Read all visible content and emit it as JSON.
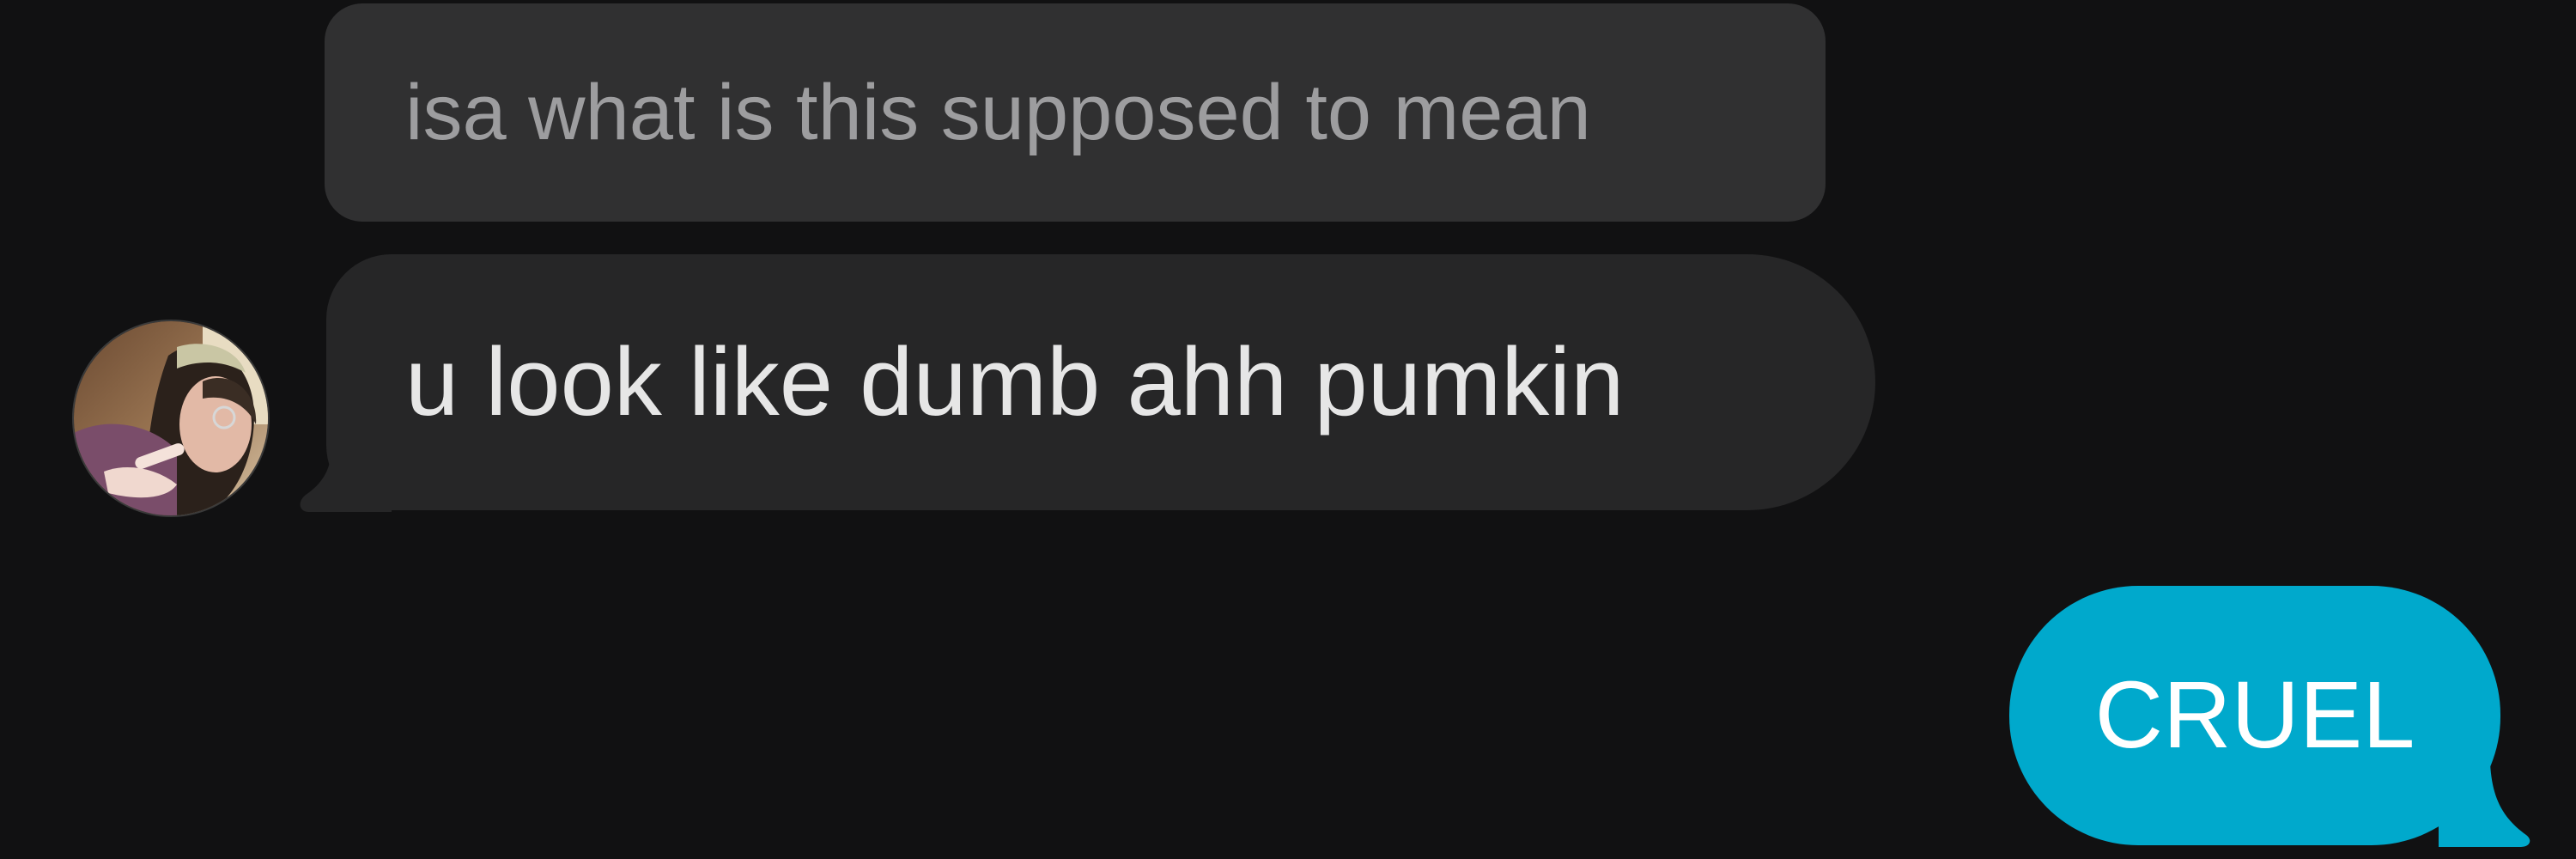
{
  "conversation": {
    "reply_preview": {
      "text": "isa what is this supposed to mean"
    },
    "messages": [
      {
        "direction": "incoming",
        "text": "u look like dumb ahh pumkin",
        "bubble_color": "#262627",
        "text_color": "#e6e6e6"
      },
      {
        "direction": "outgoing",
        "text": "CRUEL",
        "bubble_color": "#00a9cc",
        "text_color": "#ffffff"
      }
    ],
    "sender_avatar": {
      "icon": "user-avatar-photo"
    }
  },
  "theme": {
    "background": "#111112",
    "reply_preview_bg": "#303031",
    "reply_preview_text": "#9d9d9f"
  }
}
